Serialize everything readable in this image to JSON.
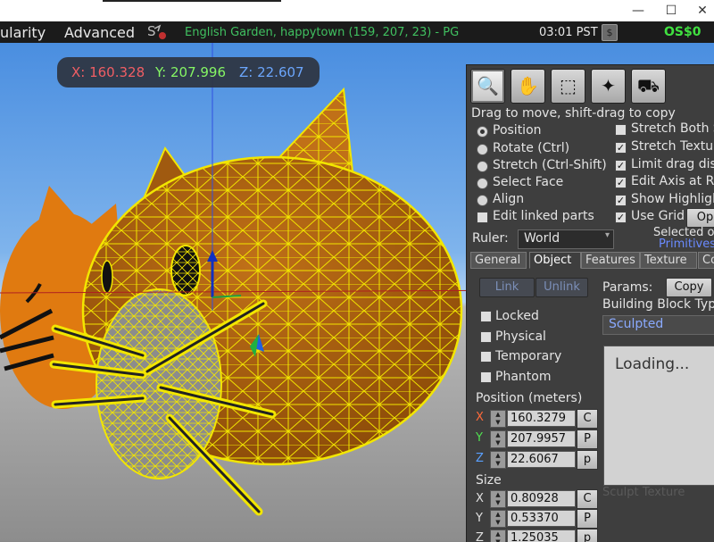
{
  "window": {
    "minimize_glyph": "—",
    "maximize_glyph": "☐",
    "close_glyph": "✕"
  },
  "menu": {
    "items": [
      "ularity",
      "Advanced"
    ],
    "location": "English Garden, happytown (159, 207, 23) - PG",
    "clock": "03:01 PST",
    "buy_icon": "$",
    "balance": "OS$0",
    "colors": {
      "location": "#40c060",
      "balance": "#40e040"
    }
  },
  "coords": {
    "x": "X: 160.328",
    "y": "Y: 207.996",
    "z": "Z: 22.607",
    "colors": {
      "x": "#ff5a5a",
      "y": "#8aff5a",
      "z": "#6ea8ff"
    }
  },
  "build": {
    "tools": [
      "zoom-icon",
      "grab-hand-icon",
      "select-box-icon",
      "create-wand-icon",
      "land-bulldozer-icon"
    ],
    "hint": "Drag to move, shift-drag to copy",
    "modes": [
      {
        "label": "Position",
        "selected": true
      },
      {
        "label": "Rotate (Ctrl)",
        "selected": false
      },
      {
        "label": "Stretch (Ctrl-Shift)",
        "selected": false
      },
      {
        "label": "Select Face",
        "selected": false
      },
      {
        "label": "Align",
        "selected": false
      }
    ],
    "edit_linked": {
      "label": "Edit linked parts",
      "checked": false
    },
    "options": [
      {
        "label": "Stretch Both Si",
        "checked": false
      },
      {
        "label": "Stretch Texture",
        "checked": true
      },
      {
        "label": "Limit drag dista",
        "checked": true
      },
      {
        "label": "Edit Axis at Roo",
        "checked": true
      },
      {
        "label": "Show Highlight",
        "checked": true
      },
      {
        "label": "Use Grid",
        "checked": true
      }
    ],
    "grid_options_button": "Op",
    "ruler_label": "Ruler:",
    "ruler_value": "World",
    "selected_text": "Selected ob",
    "primitives_text": "Primitives",
    "tabs": [
      "General",
      "Object",
      "Features",
      "Texture",
      "Co"
    ],
    "active_tab": "Object",
    "link_button": "Link",
    "unlink_button": "Unlink",
    "flags": [
      {
        "label": "Locked",
        "checked": false
      },
      {
        "label": "Physical",
        "checked": false
      },
      {
        "label": "Temporary",
        "checked": false
      },
      {
        "label": "Phantom",
        "checked": false
      }
    ],
    "params_label": "Params:",
    "copy_button": "Copy",
    "block_type_label": "Building Block Type",
    "block_type_value": "Sculpted",
    "loading_text": "Loading...",
    "sculpt_texture_label": "Sculpt Texture",
    "position_label": "Position (meters)",
    "position": [
      {
        "axis": "X",
        "value": "160.3279",
        "button": "C",
        "color": "#ff6a3a"
      },
      {
        "axis": "Y",
        "value": "207.9957",
        "button": "P",
        "color": "#50e050"
      },
      {
        "axis": "Z",
        "value": "22.6067",
        "button": "p",
        "color": "#5aa0ff"
      }
    ],
    "size_label": "Size",
    "size": [
      {
        "axis": "X",
        "value": "0.80928",
        "button": "C",
        "color": "#e4e4e4"
      },
      {
        "axis": "Y",
        "value": "0.53370",
        "button": "P",
        "color": "#e4e4e4"
      },
      {
        "axis": "Z",
        "value": "1.25035",
        "button": "p",
        "color": "#e4e4e4"
      }
    ]
  }
}
